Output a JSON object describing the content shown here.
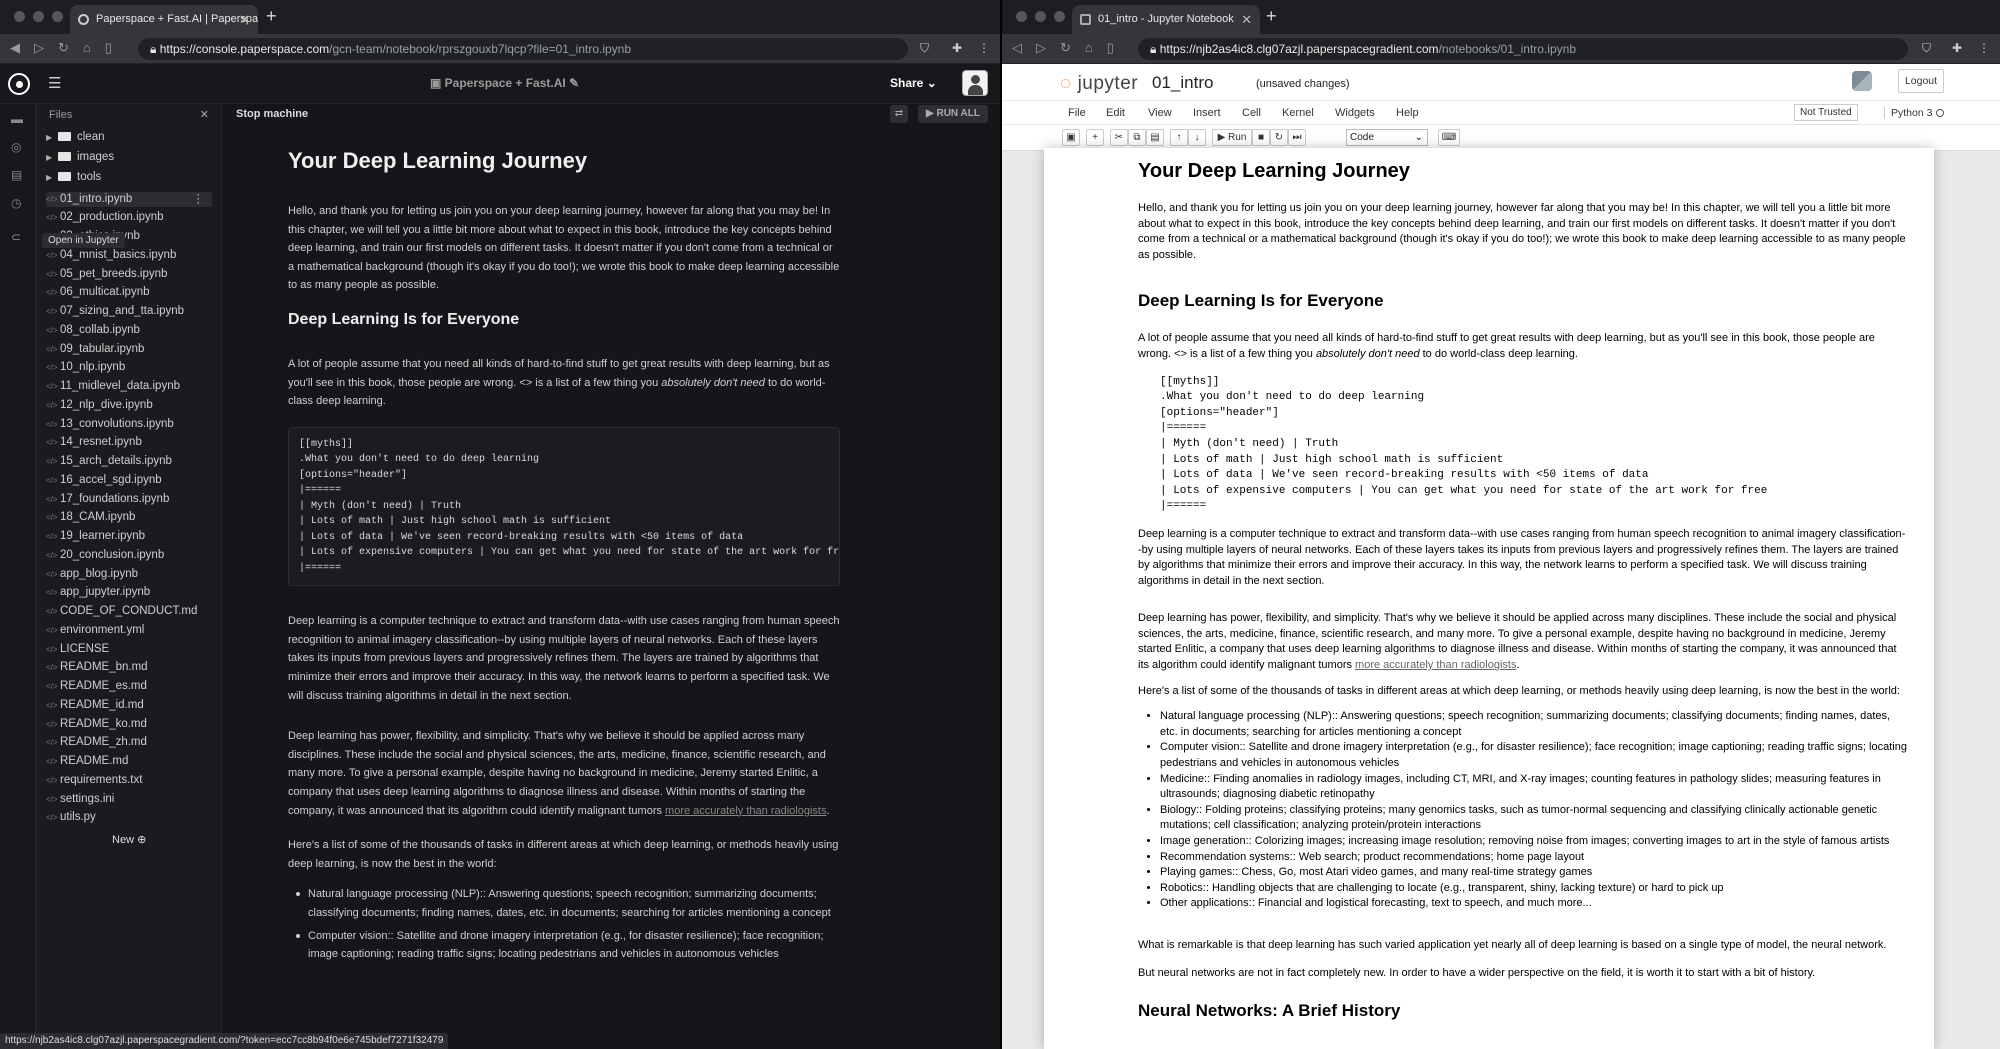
{
  "left": {
    "tab_title": "Paperspace + Fast.AI | Paperspace",
    "url_main": "https://console.paperspace.com",
    "url_rest": "/gcn-team/notebook/rprszgouxb7lqcp?file=01_intro.ipynb",
    "app_title": "Paperspace + Fast.AI",
    "share_label": "Share",
    "files_header": "Files",
    "tooltip": "Open in Jupyter",
    "folders": [
      "clean",
      "images",
      "tools"
    ],
    "files": [
      "01_intro.ipynb",
      "02_production.ipynb",
      "03_ethics.ipynb",
      "04_mnist_basics.ipynb",
      "05_pet_breeds.ipynb",
      "06_multicat.ipynb",
      "07_sizing_and_tta.ipynb",
      "08_collab.ipynb",
      "09_tabular.ipynb",
      "10_nlp.ipynb",
      "11_midlevel_data.ipynb",
      "12_nlp_dive.ipynb",
      "13_convolutions.ipynb",
      "14_resnet.ipynb",
      "15_arch_details.ipynb",
      "16_accel_sgd.ipynb",
      "17_foundations.ipynb",
      "18_CAM.ipynb",
      "19_learner.ipynb",
      "20_conclusion.ipynb",
      "app_blog.ipynb",
      "app_jupyter.ipynb",
      "CODE_OF_CONDUCT.md",
      "environment.yml",
      "LICENSE",
      "README_bn.md",
      "README_es.md",
      "README_id.md",
      "README_ko.md",
      "README_zh.md",
      "README.md",
      "requirements.txt",
      "settings.ini",
      "utils.py"
    ],
    "new_label": "New",
    "stop_label": "Stop machine",
    "run_all": "RUN ALL",
    "status_url": "https://njb2as4ic8.clg07azjl.paperspacegradient.com/?token=ecc7cc8b94f0e6e745bdef7271f32479"
  },
  "right": {
    "tab_title": "01_intro - Jupyter Notebook",
    "url_main": "https://njb2as4ic8.clg07azjl.paperspacegradient.com",
    "url_rest": "/notebooks/01_intro.ipynb",
    "jupyter_logo": "jupyter",
    "notebook_name": "01_intro",
    "unsaved": "(unsaved changes)",
    "logout": "Logout",
    "menu": [
      "File",
      "Edit",
      "View",
      "Insert",
      "Cell",
      "Kernel",
      "Widgets",
      "Help"
    ],
    "not_trusted": "Not Trusted",
    "kernel": "Python 3",
    "run_label": "Run",
    "cell_type": "Code"
  },
  "doc": {
    "h1": "Your Deep Learning Journey",
    "p1": "Hello, and thank you for letting us join you on your deep learning journey, however far along that you may be! In this chapter, we will tell you a little bit more about what to expect in this book, introduce the key concepts behind deep learning, and train our first models on different tasks. It doesn't matter if you don't come from a technical or a mathematical background (though it's okay if you do too!); we wrote this book to make deep learning accessible to as many people as possible.",
    "h2": "Deep Learning Is for Everyone",
    "p2a": "A lot of people assume that you need all kinds of hard-to-find stuff to get great results with deep learning, but as you'll see in this book, those people are wrong. <> is a list of a few thing you ",
    "p2em": "absolutely don't need",
    "p2b": " to do world-class deep learning.",
    "code": "[[myths]]\n.What you don't need to do deep learning\n[options=\"header\"]\n|======\n| Myth (don't need) | Truth\n| Lots of math | Just high school math is sufficient\n| Lots of data | We've seen record-breaking results with <50 items of data\n| Lots of expensive computers | You can get what you need for state of the art work for free\n|======",
    "p3": "Deep learning is a computer technique to extract and transform data--with use cases ranging from human speech recognition to animal imagery classification--by using multiple layers of neural networks. Each of these layers takes its inputs from previous layers and progressively refines them. The layers are trained by algorithms that minimize their errors and improve their accuracy. In this way, the network learns to perform a specified task. We will discuss training algorithms in detail in the next section.",
    "p4a": "Deep learning has power, flexibility, and simplicity. That's why we believe it should be applied across many disciplines. These include the social and physical sciences, the arts, medicine, finance, scientific research, and many more. To give a personal example, despite having no background in medicine, Jeremy started Enlitic, a company that uses deep learning algorithms to diagnose illness and disease. Within months of starting the company, it was announced that its algorithm could identify malignant tumors ",
    "p4link": "more accurately than radiologists",
    "p4b": ".",
    "p5": "Here's a list of some of the thousands of tasks in different areas at which deep learning, or methods heavily using deep learning, is now the best in the world:",
    "list": [
      "Natural language processing (NLP):: Answering questions; speech recognition; summarizing documents; classifying documents; finding names, dates, etc. in documents; searching for articles mentioning a concept",
      "Computer vision:: Satellite and drone imagery interpretation (e.g., for disaster resilience); face recognition; image captioning; reading traffic signs; locating pedestrians and vehicles in autonomous vehicles",
      "Medicine:: Finding anomalies in radiology images, including CT, MRI, and X-ray images; counting features in pathology slides; measuring features in ultrasounds; diagnosing diabetic retinopathy",
      "Biology:: Folding proteins; classifying proteins; many genomics tasks, such as tumor-normal sequencing and classifying clinically actionable genetic mutations; cell classification; analyzing protein/protein interactions",
      "Image generation:: Colorizing images; increasing image resolution; removing noise from images; converting images to art in the style of famous artists",
      "Recommendation systems:: Web search; product recommendations; home page layout",
      "Playing games:: Chess, Go, most Atari video games, and many real-time strategy games",
      "Robotics:: Handling objects that are challenging to locate (e.g., transparent, shiny, lacking texture) or hard to pick up",
      "Other applications:: Financial and logistical forecasting, text to speech, and much more..."
    ],
    "p6": "What is remarkable is that deep learning has such varied application yet nearly all of deep learning is based on a single type of model, the neural network.",
    "p7": "But neural networks are not in fact completely new. In order to have a wider perspective on the field, it is worth it to start with a bit of history.",
    "h3": "Neural Networks: A Brief History"
  }
}
